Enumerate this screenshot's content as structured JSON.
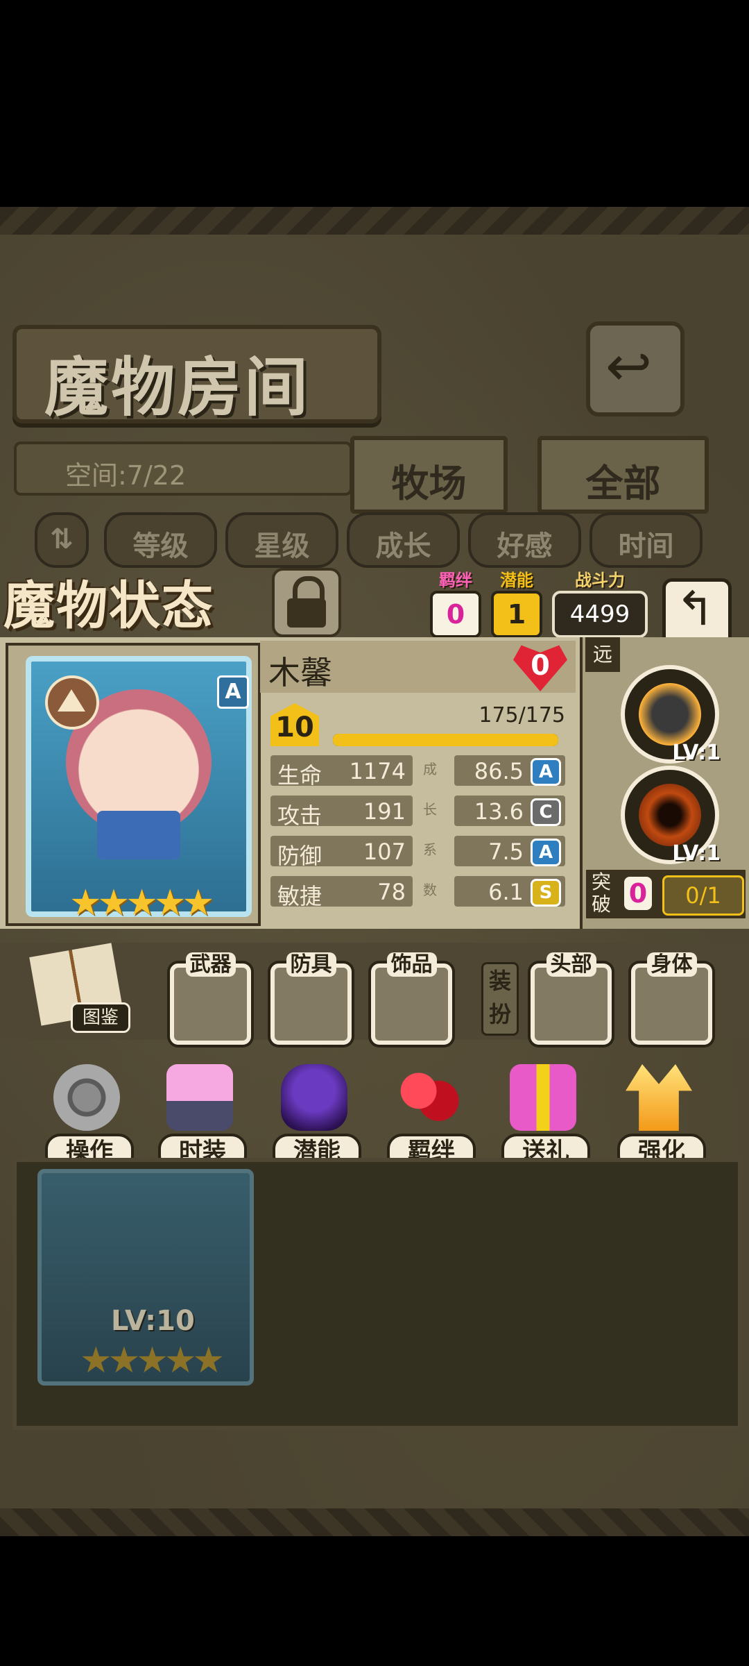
{
  "room": {
    "title": "魔物房间",
    "space": "空间:7/22",
    "tabs": [
      "牧场",
      "全部"
    ],
    "sort_buttons": [
      "等级",
      "星级",
      "成长",
      "好感",
      "时间"
    ],
    "back_icon": "return-arrow-icon"
  },
  "status": {
    "title": "魔物状态",
    "lock_icon": "padlock-icon",
    "bond": {
      "label": "羁绊",
      "value": "0"
    },
    "potential": {
      "label": "潜能",
      "value": "1"
    },
    "power": {
      "label": "战斗力",
      "value": "4499"
    }
  },
  "monster": {
    "name": "木馨",
    "affection": "0",
    "rank": "A",
    "stars": "★★★★★",
    "level": "10",
    "exp": "175/175",
    "exp_fraction": 1.0,
    "stats": [
      {
        "label": "生命",
        "value": "1174",
        "growth_char": "成",
        "growth": "86.5",
        "grade": "A",
        "grade_color": "#2f7fc0"
      },
      {
        "label": "攻击",
        "value": "191",
        "growth_char": "长",
        "growth": "13.6",
        "grade": "C",
        "grade_color": "#6b6b6b"
      },
      {
        "label": "防御",
        "value": "107",
        "growth_char": "系",
        "growth": "7.5",
        "grade": "A",
        "grade_color": "#2f7fc0"
      },
      {
        "label": "敏捷",
        "value": "78",
        "growth_char": "数",
        "growth": "6.1",
        "grade": "S",
        "grade_color": "#d8b21a"
      }
    ],
    "range": "远",
    "skills": [
      {
        "level": "LV:1",
        "icon": "dark-blob-skill-icon"
      },
      {
        "level": "LV:1",
        "icon": "fire-vortex-skill-icon"
      }
    ],
    "breakthrough": {
      "label": "突破",
      "value": "0",
      "progress": "0/1"
    }
  },
  "equipment": {
    "dex_label": "图鉴",
    "slots": [
      "武器",
      "防具",
      "饰品"
    ],
    "dress_label": "装扮",
    "dress_slots": [
      "头部",
      "身体"
    ]
  },
  "actions": [
    {
      "label": "操作",
      "icon": "gear-icon"
    },
    {
      "label": "时装",
      "icon": "outfit-icon"
    },
    {
      "label": "潜能",
      "icon": "shadow-demon-icon"
    },
    {
      "label": "羁绊",
      "icon": "red-hearts-icon"
    },
    {
      "label": "送礼",
      "icon": "gift-box-icon"
    },
    {
      "label": "强化",
      "icon": "upgrade-arrows-icon"
    }
  ],
  "list": {
    "card_level": "LV:10",
    "card_stars": "★★★★★"
  }
}
